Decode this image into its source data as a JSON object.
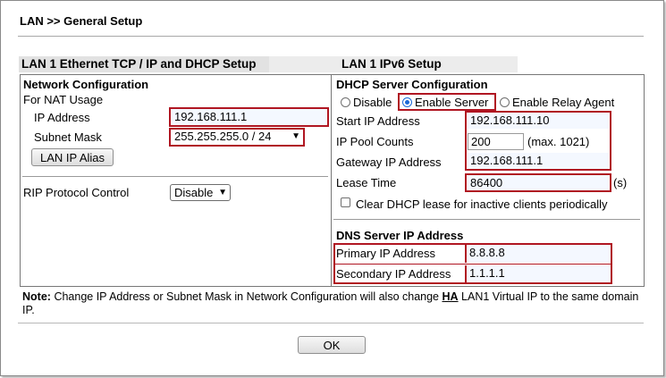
{
  "page": {
    "title": "LAN >> General Setup"
  },
  "tabs": [
    {
      "label": "LAN 1 Ethernet TCP / IP and DHCP Setup",
      "active": true
    },
    {
      "label": "LAN 1 IPv6 Setup",
      "active": false
    }
  ],
  "network": {
    "heading": "Network Configuration",
    "nat_label": "For NAT Usage",
    "ip_label": "IP Address",
    "ip_value": "192.168.111.1",
    "subnet_label": "Subnet Mask",
    "subnet_value": "255.255.255.0 / 24",
    "alias_button": "LAN IP Alias",
    "rip_label": "RIP Protocol Control",
    "rip_value": "Disable"
  },
  "dhcp": {
    "heading": "DHCP Server Configuration",
    "modes": [
      "Disable",
      "Enable Server",
      "Enable Relay Agent"
    ],
    "selected_mode": "Enable Server",
    "start_label": "Start IP Address",
    "start_value": "192.168.111.10",
    "pool_label": "IP Pool Counts",
    "pool_value": "200",
    "pool_max": "(max. 1021)",
    "gateway_label": "Gateway IP Address",
    "gateway_value": "192.168.111.1",
    "lease_label": "Lease Time",
    "lease_value": "86400",
    "lease_unit": "(s)",
    "clear_label": "Clear DHCP lease for inactive clients periodically",
    "clear_checked": false
  },
  "dns": {
    "heading": "DNS Server IP Address",
    "primary_label": "Primary IP Address",
    "primary_value": "8.8.8.8",
    "secondary_label": "Secondary IP Address",
    "secondary_value": "1.1.1.1"
  },
  "note": {
    "label": "Note:",
    "text_before": "Change IP Address or Subnet Mask in Network Configuration will also change",
    "link": "HA",
    "text_after": "LAN1 Virtual IP to the same domain IP."
  },
  "actions": {
    "ok_label": "OK"
  },
  "colors": {
    "highlight_border": "#b01622",
    "radio_accent": "#1a6ad8",
    "tab_active_bg": "#e2e2e2"
  }
}
